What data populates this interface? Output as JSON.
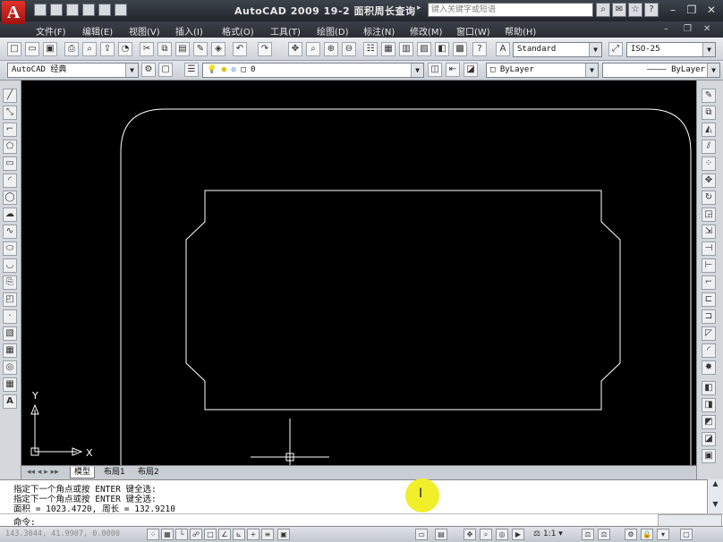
{
  "app": {
    "logo_letter": "A",
    "title": "AutoCAD 2009  19-2 面积周长查询"
  },
  "search": {
    "placeholder": "键入关键字或短语"
  },
  "menus": [
    "文件(F)",
    "编辑(E)",
    "视图(V)",
    "插入(I)",
    "格式(O)",
    "工具(T)",
    "绘图(D)",
    "标注(N)",
    "修改(M)",
    "窗口(W)",
    "帮助(H)"
  ],
  "toolbar": {
    "text_style": "Standard",
    "dim_style": "ISO-25",
    "workspace": "AutoCAD 经典",
    "layer": "0",
    "color": "ByLayer",
    "linetype": "ByLayer"
  },
  "ucs": {
    "x_label": "X",
    "y_label": "Y"
  },
  "layout_tabs": [
    "模型",
    "布局1",
    "布局2"
  ],
  "command_history": [
    "指定下一个角点或按 ENTER 键全选:",
    "指定下一个角点或按 ENTER 键全选:",
    "面积 = 1023.4720, 周长 = 132.9210"
  ],
  "command_prompt": "命令:",
  "status": {
    "coordinates": "143.3044, 41.9907, 0.0000",
    "annotation_scale": "1:1"
  },
  "colors": {
    "canvas": "#000000",
    "geometry": "#ffffff",
    "highlight": "#f1ee2a"
  }
}
